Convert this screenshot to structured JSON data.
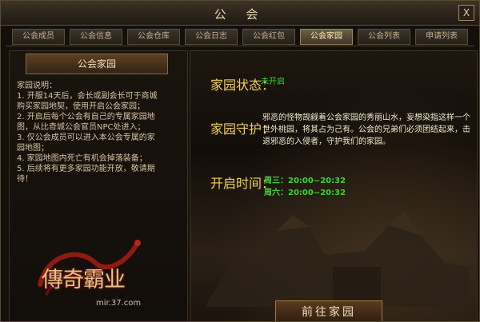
{
  "window": {
    "title": "公 会",
    "close_label": "X"
  },
  "tabs": [
    {
      "label": "公会成员",
      "active": false
    },
    {
      "label": "公会信息",
      "active": false
    },
    {
      "label": "公会仓库",
      "active": false
    },
    {
      "label": "公会日志",
      "active": false
    },
    {
      "label": "公会红包",
      "active": false
    },
    {
      "label": "公会家园",
      "active": true
    },
    {
      "label": "公会列表",
      "active": false
    },
    {
      "label": "申请列表",
      "active": false
    }
  ],
  "left": {
    "header": "公会家园",
    "desc_lines": [
      "家园说明：",
      "1. 开服14天后，会长或副会长可于商城",
      "购买家园地契，使用开启公会家园；",
      "2. 开启后每个公会有自己的专属家园地",
      "图，从比奇城公会官员NPC处进入；",
      "3. 仅公会成员可以进入本公会专属的家",
      "园地图；",
      "4. 家园地图内死亡有机会掉落装备；",
      "5. 后续将有更多家园功能开放，敬请期",
      "待！"
    ],
    "logo": {
      "title": "傳奇霸业",
      "url": "mir.37.com"
    }
  },
  "right": {
    "status_label": "家园状态：",
    "status_value": "未开启",
    "guard_label": "家园守护：",
    "guard_text": "邪恶的怪物觊觎着公会家园的秀丽山水，妄想染指这样一个世外桃园，将其占为己有。公会的兄弟们必须团结起来，击退邪恶的入侵者，守护我们的家园。",
    "time_label": "开启时间：",
    "times": [
      "周三：20:00~20:32",
      "周六：20:00~20:32"
    ],
    "button_label": "前往家园"
  },
  "colors": {
    "label": "#f0d15e",
    "accent_green": "#3fd43a",
    "border": "#5a4a33"
  }
}
